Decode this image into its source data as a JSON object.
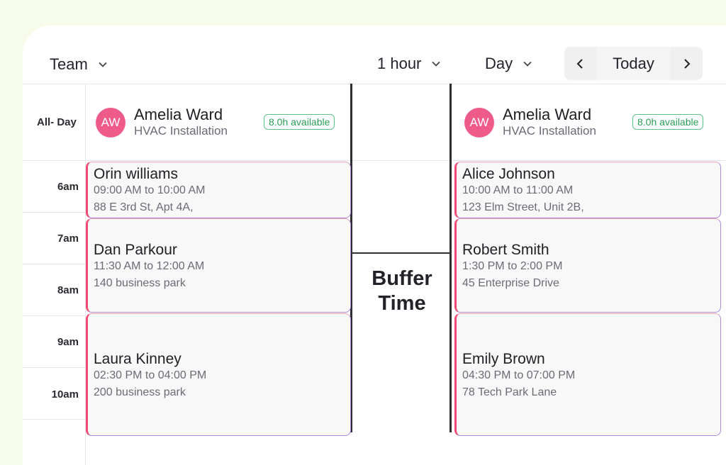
{
  "toolbar": {
    "team_label": "Team",
    "interval_label": "1 hour",
    "view_label": "Day",
    "today_label": "Today",
    "prev_icon": "chevron-left-icon",
    "next_icon": "chevron-right-icon"
  },
  "time_labels": [
    "All- Day",
    "6am",
    "7am",
    "8am",
    "9am",
    "10am"
  ],
  "buffer_label": "Buffer Time",
  "columns": [
    {
      "avatar_initials": "AW",
      "name": "Amelia Ward",
      "role": "HVAC Installation",
      "availability": "8.0h available",
      "events": [
        {
          "name": "Orin williams",
          "time": "09:00 AM to 10:00 AM",
          "address": "88 E 3rd St, Apt 4A,"
        },
        {
          "name": "Dan Parkour",
          "time": "11:30 AM to 12:00 AM",
          "address": "140 business park"
        },
        {
          "name": "Laura Kinney",
          "time": "02:30 PM to 04:00 PM",
          "address": "200 business park"
        }
      ]
    },
    {
      "avatar_initials": "AW",
      "name": "Amelia Ward",
      "role": "HVAC Installation",
      "availability": "8.0h available",
      "events": [
        {
          "name": "Alice Johnson",
          "time": "10:00 AM to 11:00 AM",
          "address": "123 Elm Street, Unit 2B,"
        },
        {
          "name": "Robert Smith",
          "time": "1:30 PM to 2:00 PM",
          "address": "45 Enterprise Drive"
        },
        {
          "name": "Emily Brown",
          "time": "04:30 PM to 07:00 PM",
          "address": "78 Tech Park Lane"
        }
      ]
    }
  ],
  "colors": {
    "accent": "#ee4a74",
    "avatar": "#ee5a8a",
    "available": "#2a9c57",
    "background": "#f7fbe9"
  }
}
